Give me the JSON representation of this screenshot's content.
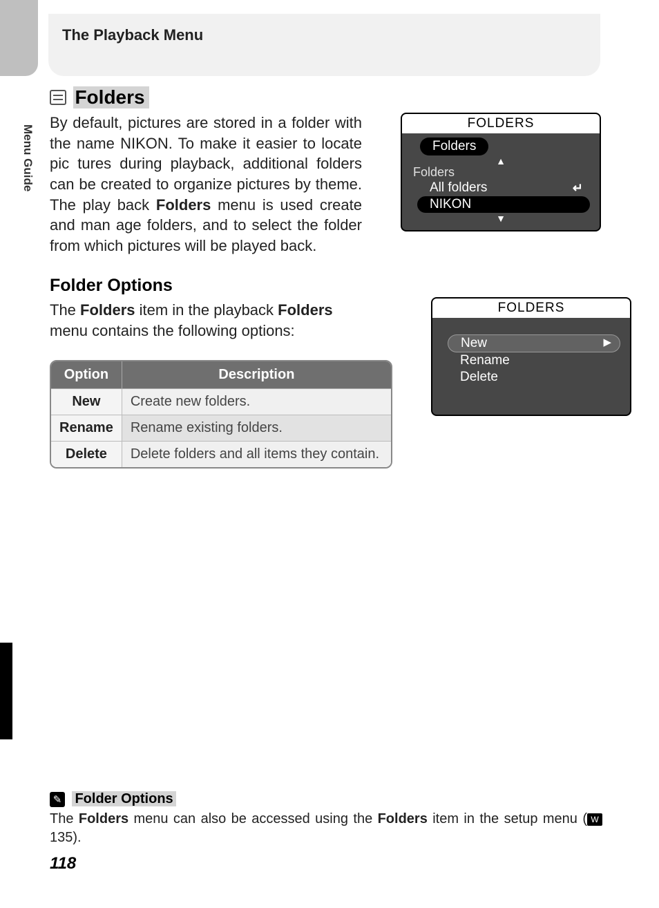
{
  "header": {
    "title": "The Playback Menu"
  },
  "side_label": "Menu Guide",
  "section": {
    "title": "Folders",
    "intro_parts": [
      "By default, pictures are stored in a folder with the name NIKON.  To make it easier to locate pic tures during playback, additional folders can be created to organize pictures by theme.  The play back ",
      "Folders",
      " menu is used create and man age folders, and to select the folder from which pictures will be played back."
    ],
    "sub_heading": "Folder Options",
    "sub_body_parts": [
      "The ",
      "Folders",
      " item in the playback ",
      "Folders",
      " menu contains the following options:"
    ]
  },
  "table": {
    "headers": [
      "Option",
      "Description"
    ],
    "rows": [
      {
        "option": "New",
        "desc": "Create new folders."
      },
      {
        "option": "Rename",
        "desc": "Rename existing folders."
      },
      {
        "option": "Delete",
        "desc": "Delete folders and all items they contain."
      }
    ]
  },
  "screen1": {
    "title": "FOLDERS",
    "selected_pill": "Folders",
    "sub_label": "Folders",
    "options": [
      "All folders",
      "NIKON"
    ],
    "selected_index": 1
  },
  "screen2": {
    "title": "FOLDERS",
    "options": [
      "New",
      "Rename",
      "Delete"
    ],
    "selected_index": 0
  },
  "tip": {
    "heading": "Folder Options",
    "body_parts": [
      "The ",
      "Folders",
      " menu can also be accessed using the ",
      "Folders",
      " item in the setup menu ("
    ],
    "page_ref": " 135).",
    "ref_icon_label": "W"
  },
  "page_number": "118"
}
